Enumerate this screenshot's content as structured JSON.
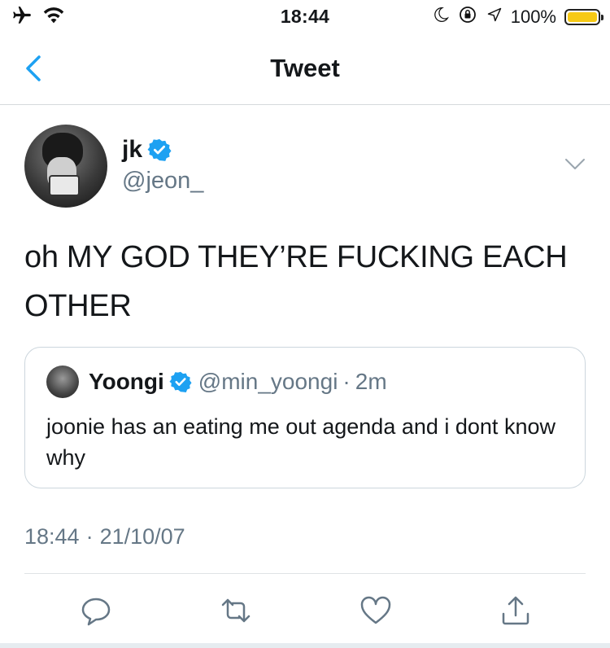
{
  "status_bar": {
    "time": "18:44",
    "battery_percent": "100%",
    "battery_level": 1.0,
    "icons": [
      "airplane-icon",
      "wifi-icon",
      "moon-icon",
      "orientation-lock-icon",
      "location-arrow-icon",
      "battery-icon"
    ]
  },
  "nav": {
    "title": "Tweet",
    "back_icon": "chevron-left-icon"
  },
  "tweet": {
    "author_name": "jk",
    "author_handle": "@jeon_",
    "verified": true,
    "text": "oh MY GOD THEY’RE FUCKING EACH OTHER",
    "timestamp_time": "18:44",
    "timestamp_sep": "·",
    "timestamp_date": "21/10/07"
  },
  "quote": {
    "name": "Yoongi",
    "handle": "@min_yoongi",
    "separator": "·",
    "time": "2m",
    "text": "joonie has an eating me out agenda and i dont know why"
  },
  "actions": [
    "reply-icon",
    "retweet-icon",
    "like-icon",
    "share-icon"
  ],
  "colors": {
    "accent": "#1da1f2",
    "secondary_text": "#657786",
    "battery": "#f6c915"
  }
}
